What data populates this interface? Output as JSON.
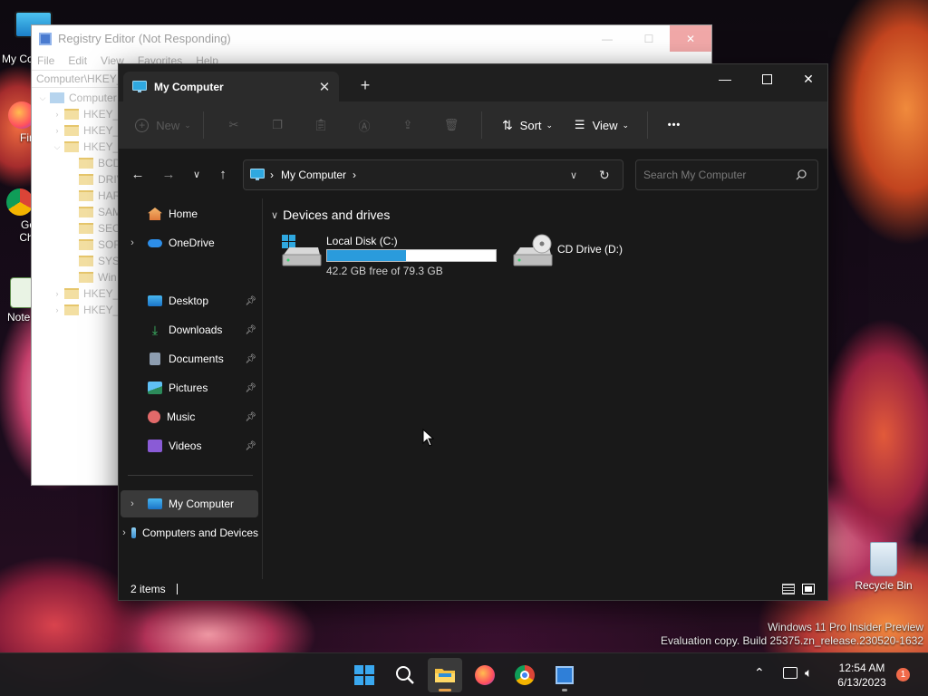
{
  "desktop": {
    "icons": [
      {
        "label": "My Co"
      },
      {
        "label": "Fir"
      },
      {
        "label": "Go Chr"
      },
      {
        "label": "Note"
      },
      {
        "label": "Recycle Bin"
      }
    ],
    "watermark_line1": "Windows 11 Pro Insider Preview",
    "watermark_line2": "Evaluation copy. Build 25375.zn_release.230520-1632"
  },
  "regedit": {
    "title": "Registry Editor (Not Responding)",
    "menu": [
      "File",
      "Edit",
      "View",
      "Favorites",
      "Help"
    ],
    "path": "Computer\\HKEY_",
    "tree": [
      {
        "label": "Computer",
        "level": 0,
        "kind": "pc"
      },
      {
        "label": "HKEY_C",
        "level": 1,
        "kind": "folder"
      },
      {
        "label": "HKEY_C",
        "level": 1,
        "kind": "folder"
      },
      {
        "label": "HKEY_L",
        "level": 1,
        "kind": "folder"
      },
      {
        "label": "BCD",
        "level": 2,
        "kind": "folder"
      },
      {
        "label": "DRIV",
        "level": 2,
        "kind": "folder"
      },
      {
        "label": "HAR",
        "level": 2,
        "kind": "folder"
      },
      {
        "label": "SAM",
        "level": 2,
        "kind": "folder"
      },
      {
        "label": "SEC",
        "level": 2,
        "kind": "folder"
      },
      {
        "label": "SOF",
        "level": 2,
        "kind": "folder"
      },
      {
        "label": "SYS",
        "level": 2,
        "kind": "folder"
      },
      {
        "label": "Win",
        "level": 2,
        "kind": "folder"
      },
      {
        "label": "HKEY_U",
        "level": 1,
        "kind": "folder"
      },
      {
        "label": "HKEY_C",
        "level": 1,
        "kind": "folder"
      }
    ]
  },
  "explorer": {
    "tab_title": "My Computer",
    "new_tab": "+",
    "toolbar": {
      "new_label": "New",
      "sort_label": "Sort",
      "view_label": "View",
      "more_label": "•••"
    },
    "address": {
      "location": "My Computer",
      "search_placeholder": "Search My Computer"
    },
    "sidebar": {
      "home": "Home",
      "onedrive": "OneDrive",
      "quick_access": [
        "Desktop",
        "Downloads",
        "Documents",
        "Pictures",
        "Music",
        "Videos"
      ],
      "this_pc": "My Computer",
      "network": "Computers and Devices"
    },
    "content": {
      "group_label": "Devices and drives",
      "drives": [
        {
          "name": "Local Disk (C:)",
          "free_text": "42.2 GB free of 79.3 GB",
          "used_fraction": 0.468
        },
        {
          "name": "CD Drive (D:)"
        }
      ]
    },
    "status": {
      "items_count": "2 items"
    }
  },
  "taskbar": {
    "time": "12:54 AM",
    "date": "6/13/2023",
    "notification_count": "1"
  }
}
